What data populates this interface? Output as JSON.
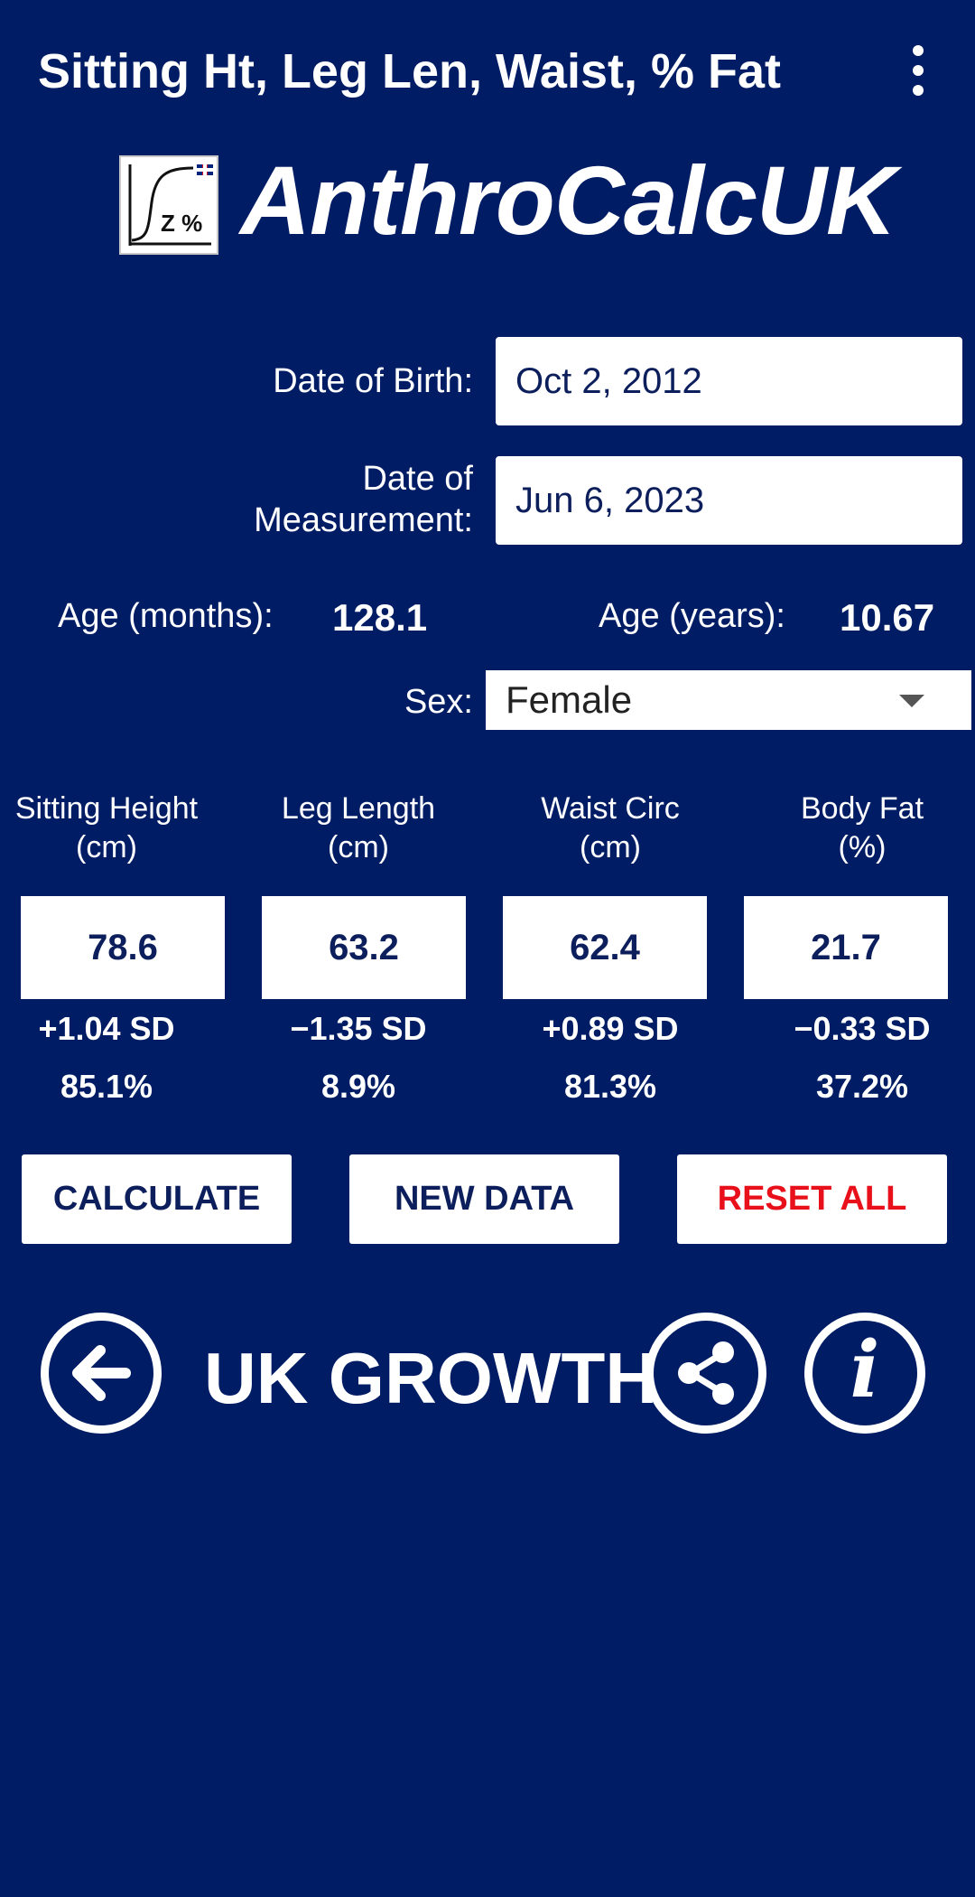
{
  "toolbar": {
    "title": "Sitting Ht, Leg Len, Waist, % Fat",
    "menu_icon": "overflow-menu-icon"
  },
  "header": {
    "app_name": "AnthroCalcUK",
    "logo_text": "Z %",
    "logo_icon": "growth-curve-logo-icon"
  },
  "form": {
    "dob_label": "Date of Birth:",
    "dob_value": "Oct 2, 2012",
    "dom_label_line1": "Date of",
    "dom_label_line2": "Measurement:",
    "dom_value": "Jun 6, 2023",
    "age_months_label": "Age (months):",
    "age_months_value": "128.1",
    "age_years_label": "Age (years):",
    "age_years_value": "10.67",
    "sex_label": "Sex:",
    "sex_value": "Female"
  },
  "measurements": [
    {
      "name_line1": "Sitting Height",
      "name_line2": "(cm)",
      "value": "78.6",
      "sd": "+1.04 SD",
      "percentile": "85.1%"
    },
    {
      "name_line1": "Leg Length",
      "name_line2": "(cm)",
      "value": "63.2",
      "sd": "−1.35 SD",
      "percentile": "8.9%"
    },
    {
      "name_line1": "Waist Circ",
      "name_line2": "(cm)",
      "value": "62.4",
      "sd": "+0.89 SD",
      "percentile": "81.3%"
    },
    {
      "name_line1": "Body Fat",
      "name_line2": "(%)",
      "value": "21.7",
      "sd": "−0.33 SD",
      "percentile": "37.2%"
    }
  ],
  "buttons": {
    "calculate": "CALCULATE",
    "new_data": "NEW DATA",
    "reset_all": "RESET ALL"
  },
  "footer": {
    "brand": "UK GROWTH",
    "back_icon": "arrow-left-icon",
    "share_icon": "share-icon",
    "info_icon": "info-icon",
    "info_glyph": "i"
  },
  "colors": {
    "background": "#001c64",
    "text_dark": "#0c1f5c",
    "reset_red": "#e8101a"
  }
}
